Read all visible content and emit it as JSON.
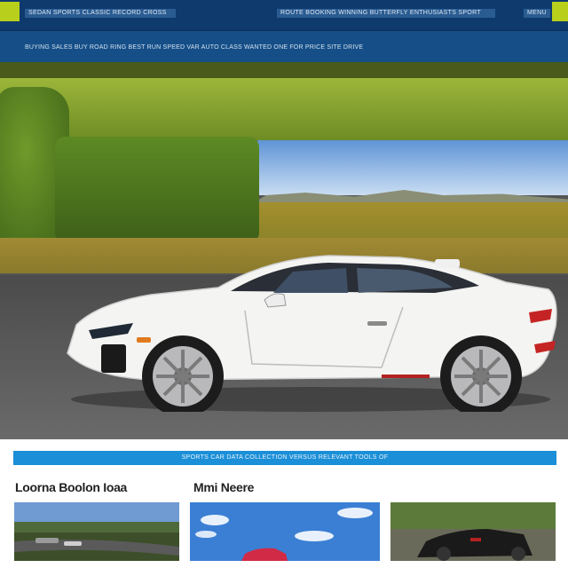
{
  "topbar": {
    "nav_left_text": "SEDAN SPORTS CLASSIC RECORD CROSS",
    "nav_center_text": "ROUTE BOOKING WINNING BUTTERFLY ENTHUSIASTS SPORT",
    "nav_right_text": "MENU",
    "accent_color": "#b8cf1c",
    "bar_color": "#0f3a6e"
  },
  "subbar": {
    "text": "BUYING SALES BUY ROAD RING BEST RUN SPEED VAR AUTO CLASS WANTED ONE FOR PRICE SITE DRIVE"
  },
  "hero": {
    "image_description_icon": "sports-car-photo"
  },
  "section_banner": {
    "text": "SPORTS CAR DATA COLLECTION VERSUS RELEVANT TOOLS OF"
  },
  "headings": {
    "left": "Loorna Boolon Ioaa",
    "right": "Mmi Neere"
  },
  "thumbnails": [
    {
      "icon": "race-track-photo"
    },
    {
      "icon": "red-car-photo"
    },
    {
      "icon": "black-car-photo"
    }
  ],
  "colors": {
    "banner": "#1b8fd8",
    "subbar": "#164f88"
  }
}
